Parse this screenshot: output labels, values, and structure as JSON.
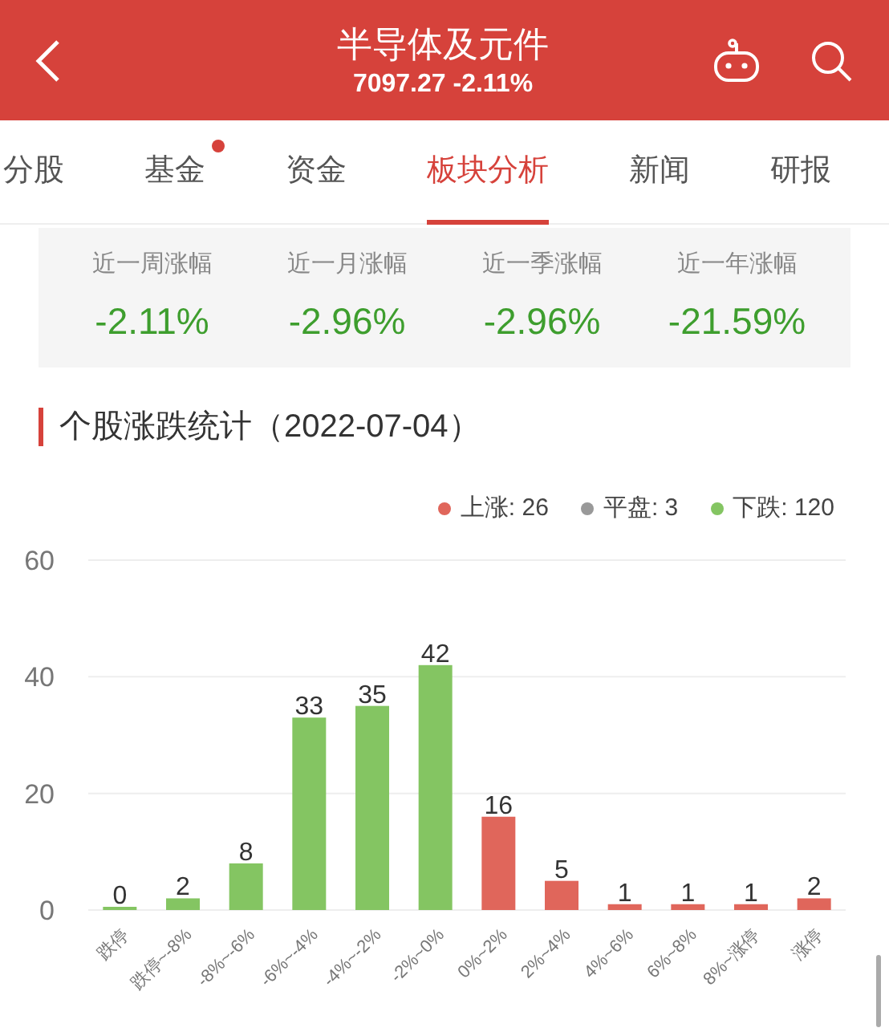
{
  "header": {
    "title": "半导体及元件",
    "subtitle": "7097.27 -2.11%"
  },
  "tabs": [
    {
      "label": "分股",
      "selected": false,
      "dot": false
    },
    {
      "label": "基金",
      "selected": false,
      "dot": true
    },
    {
      "label": "资金",
      "selected": false,
      "dot": false
    },
    {
      "label": "板块分析",
      "selected": true,
      "dot": false
    },
    {
      "label": "新闻",
      "selected": false,
      "dot": false
    },
    {
      "label": "研报",
      "selected": false,
      "dot": false
    }
  ],
  "returns": [
    {
      "label": "近一周涨幅",
      "value": "-2.11%"
    },
    {
      "label": "近一月涨幅",
      "value": "-2.96%"
    },
    {
      "label": "近一季涨幅",
      "value": "-2.96%"
    },
    {
      "label": "近一年涨幅",
      "value": "-21.59%"
    }
  ],
  "section_title": "个股涨跌统计（2022-07-04）",
  "legend": [
    {
      "label": "上涨: 26",
      "color": "#e0665b"
    },
    {
      "label": "平盘: 3",
      "color": "#999999"
    },
    {
      "label": "下跌: 120",
      "color": "#84c562"
    }
  ],
  "chart_data": {
    "type": "bar",
    "categories": [
      "跌停",
      "跌停~-8%",
      "-8%~-6%",
      "-6%~-4%",
      "-4%~-2%",
      "-2%~0%",
      "0%~2%",
      "2%~4%",
      "4%~6%",
      "6%~8%",
      "8%~涨停",
      "涨停"
    ],
    "series": [
      {
        "color": "#84c562",
        "values": [
          0,
          2,
          8,
          33,
          35,
          42,
          null,
          null,
          null,
          null,
          null,
          null
        ]
      },
      {
        "color": "#e0665b",
        "values": [
          null,
          null,
          null,
          null,
          null,
          null,
          16,
          5,
          1,
          1,
          1,
          2
        ]
      }
    ],
    "ylim": [
      0,
      60
    ],
    "yticks": [
      0,
      20,
      40,
      60
    ],
    "data_labels": true
  }
}
